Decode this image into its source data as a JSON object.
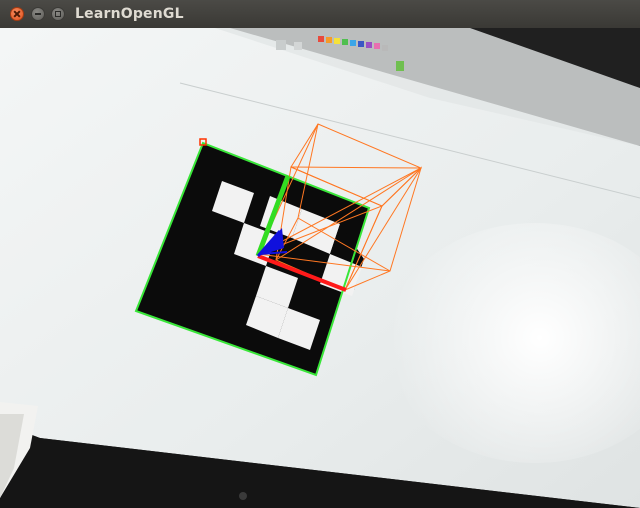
{
  "window": {
    "title": "LearnOpenGL",
    "controls": {
      "close": "close",
      "minimize": "minimize",
      "maximize": "maximize"
    }
  },
  "scene": {
    "marker": {
      "type": "aruco",
      "outline_color": "#39e639",
      "corner_color": "#ff3300"
    },
    "axes": {
      "x_color": "#ff1a1a",
      "y_color": "#33dd22",
      "z_color": "#1010dd"
    },
    "cube": {
      "color": "#ff7722",
      "style": "wireframe"
    }
  },
  "colors": {
    "titlebar": "#403f3b",
    "monitor_screen": "#eef1f0",
    "bezel": "#161616"
  }
}
